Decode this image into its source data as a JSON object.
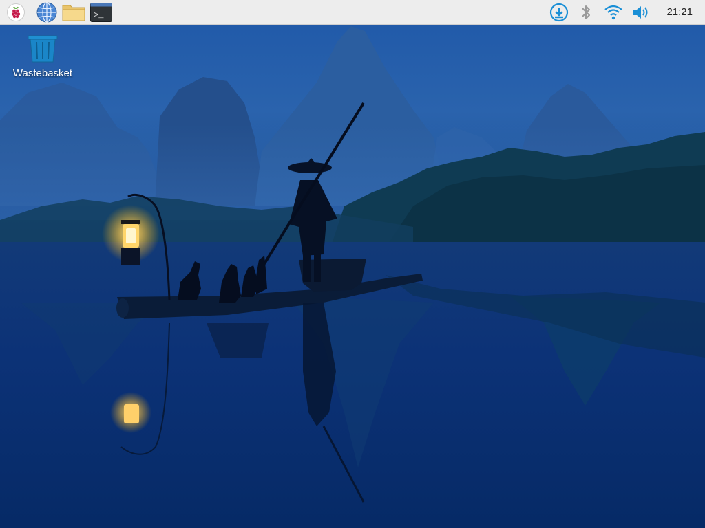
{
  "taskbar": {
    "launchers": [
      {
        "icon": "raspberry-pi-menu-icon"
      },
      {
        "icon": "web-browser-globe-icon"
      },
      {
        "icon": "file-manager-folder-icon"
      },
      {
        "icon": "terminal-icon",
        "glyph": ">_"
      }
    ],
    "tray": [
      {
        "icon": "updates-download-icon",
        "color": "#1a8fd6"
      },
      {
        "icon": "bluetooth-icon",
        "color": "#9a9a9a"
      },
      {
        "icon": "wifi-icon",
        "color": "#1a8fd6"
      },
      {
        "icon": "volume-icon",
        "color": "#1a8fd6"
      }
    ],
    "clock": "21:21"
  },
  "desktop": {
    "icons": [
      {
        "label": "Wastebasket",
        "icon": "wastebasket-icon"
      }
    ]
  },
  "colors": {
    "taskbar_bg": "#ededed",
    "accent": "#1a8fd6",
    "wallpaper_sky": "#1d4f9a",
    "wallpaper_water": "#0a2f6e"
  }
}
